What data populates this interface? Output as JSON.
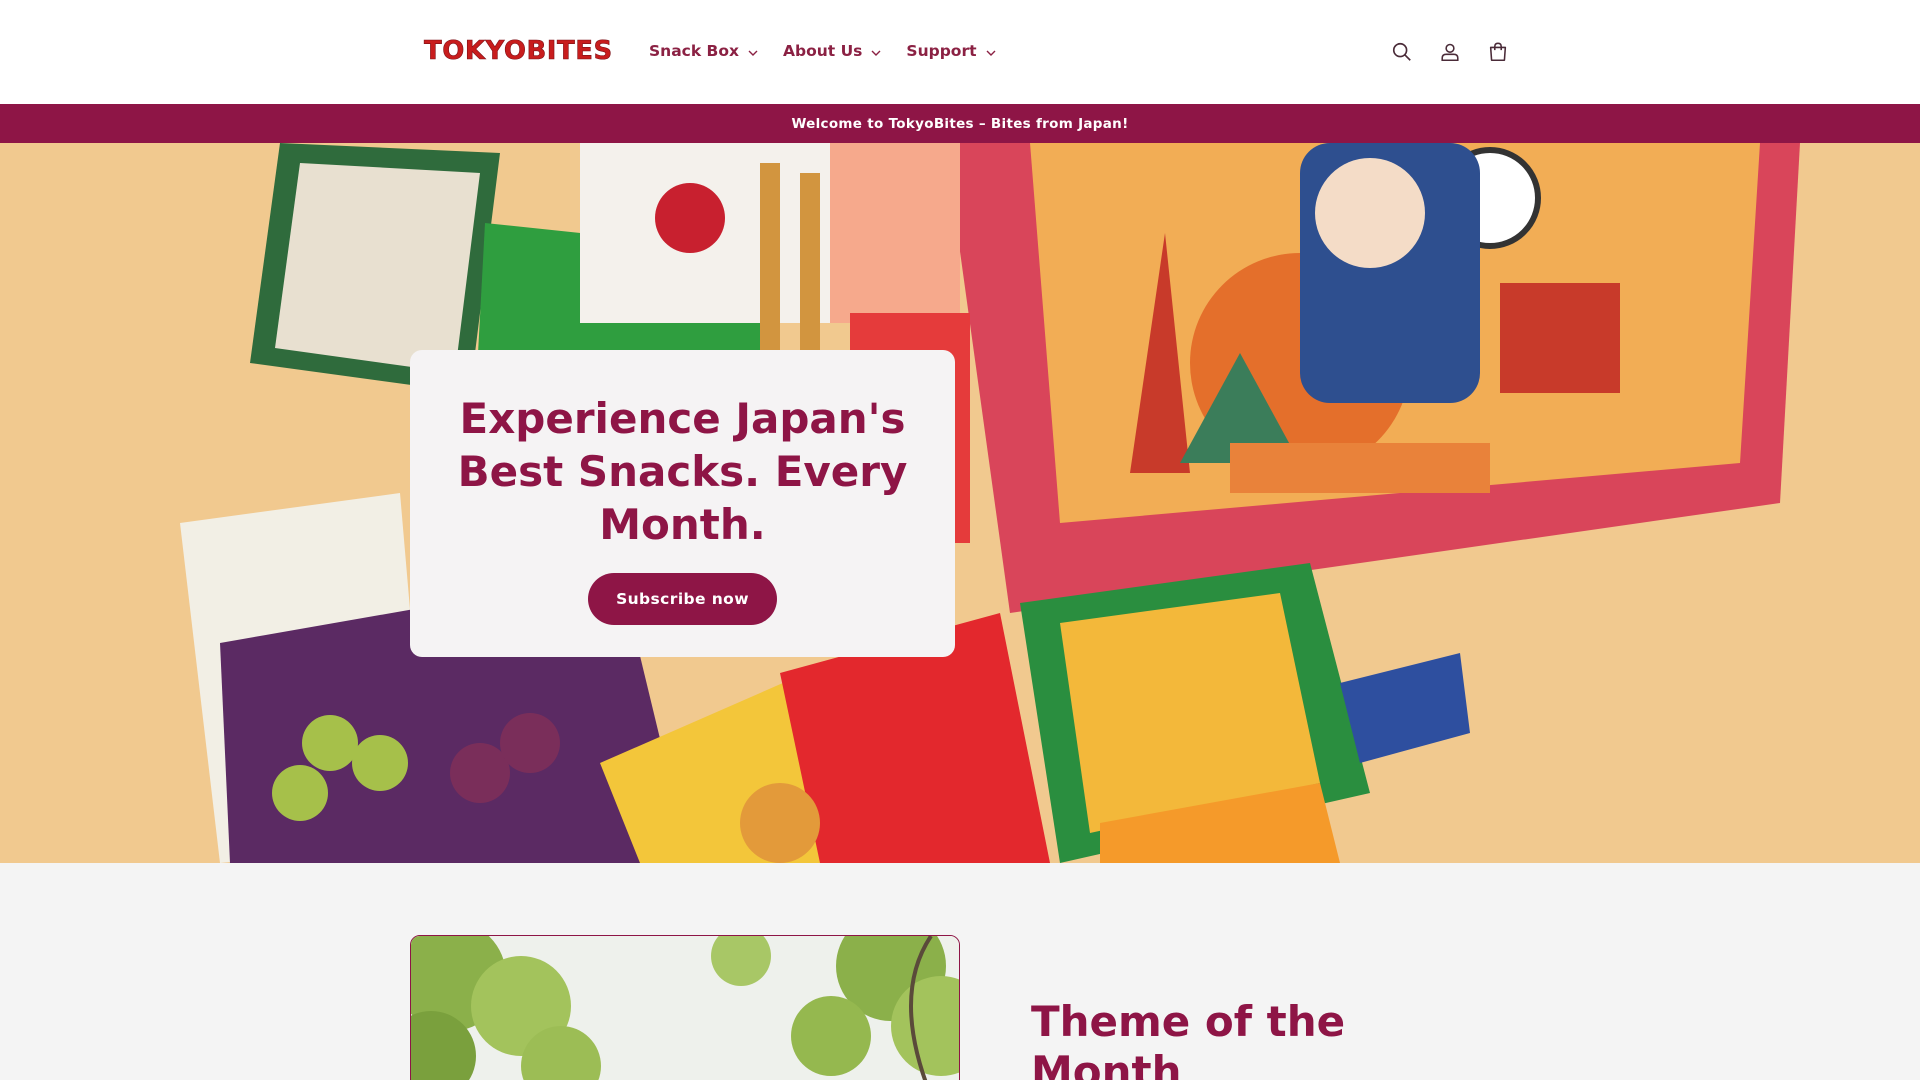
{
  "header": {
    "logo": "TOKYOBITES",
    "nav": [
      {
        "label": "Snack Box"
      },
      {
        "label": "About Us"
      },
      {
        "label": "Support"
      }
    ],
    "icons": [
      "search-icon",
      "account-icon",
      "cart-icon"
    ]
  },
  "announcement": {
    "text": "Welcome to TokyoBites – Bites from Japan!"
  },
  "hero": {
    "title": "Experience Japan's Best Snacks. Every Month.",
    "button_label": "Subscribe now"
  },
  "feature": {
    "title": "Theme of the Month"
  },
  "colors": {
    "brand": "#8e1546",
    "logo": "#c81d1d",
    "background": "#f4f4f4"
  }
}
